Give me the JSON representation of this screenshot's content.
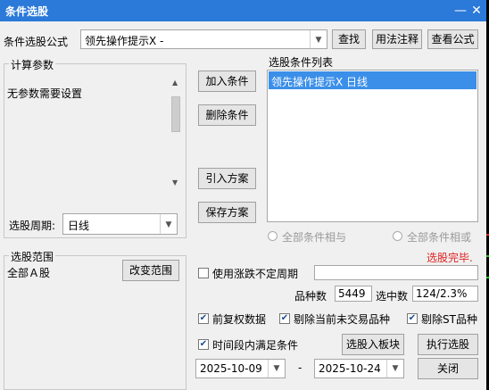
{
  "window": {
    "title": "条件选股",
    "minimize_icon": "minimize-icon",
    "close_icon": "close-icon"
  },
  "formula": {
    "label": "条件选股公式",
    "value": "领先操作提示X  -",
    "find": "查找",
    "usage": "用法注释",
    "view": "查看公式"
  },
  "params": {
    "group_label": "计算参数",
    "text": "无参数需要设置",
    "period_label": "选股周期:",
    "period_value": "日线"
  },
  "actions": {
    "add": "加入条件",
    "delete": "删除条件",
    "import": "引入方案",
    "save": "保存方案"
  },
  "conditions": {
    "label": "选股条件列表",
    "items": [
      "领先操作提示X  日线"
    ]
  },
  "logic": {
    "and": "全部条件相与",
    "or": "全部条件相或"
  },
  "status": {
    "text": "选股完毕.",
    "color": "#e02020"
  },
  "scope": {
    "group_label": "选股范围",
    "value": "全部Ａ股",
    "change": "改变范围"
  },
  "options": {
    "uncertain_period": "使用涨跌不定周期",
    "count_label": "品种数",
    "count_value": "5449",
    "selected_label": "选中数",
    "selected_value": "124/2.3%",
    "adjust": "前复权数据",
    "exclude_halted": "剔除当前未交易品种",
    "exclude_st": "剔除ST品种",
    "time_range": "时间段内满足条件"
  },
  "buttons": {
    "to_block": "选股入板块",
    "execute": "执行选股",
    "close": "关闭"
  },
  "dates": {
    "start": "2025-10-09",
    "sep": "-",
    "end": "2025-10-24"
  }
}
